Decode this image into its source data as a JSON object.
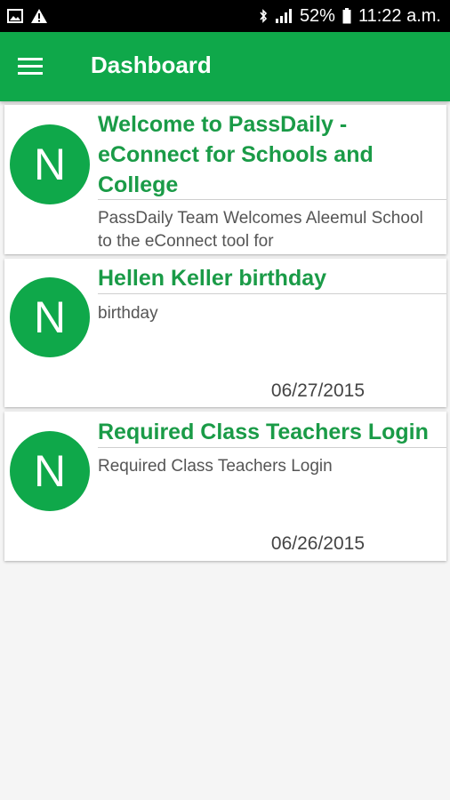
{
  "status_bar": {
    "battery": "52%",
    "time": "11:22 a.m."
  },
  "app_bar": {
    "title": "Dashboard"
  },
  "notices": [
    {
      "avatar_letter": "N",
      "title": "Welcome to PassDaily - eConnect for Schools and College",
      "body": "PassDaily Team Welcomes Aleemul School to the eConnect tool for",
      "date": ""
    },
    {
      "avatar_letter": "N",
      "title": "Hellen Keller birthday",
      "body": "birthday",
      "date": "06/27/2015"
    },
    {
      "avatar_letter": "N",
      "title": "Required Class Teachers Login",
      "body": "Required Class Teachers Login",
      "date": "06/26/2015"
    }
  ]
}
